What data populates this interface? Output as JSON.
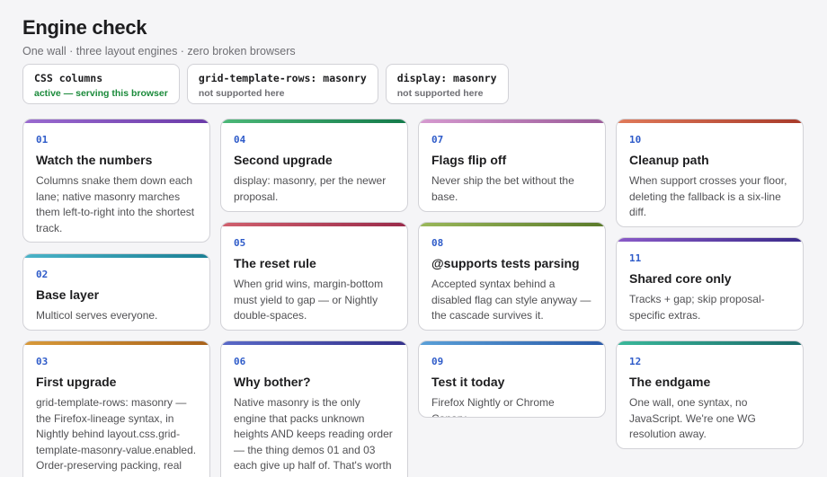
{
  "header": {
    "title": "Engine check",
    "subtitle": "One wall · three layout engines · zero broken browsers"
  },
  "engines": [
    {
      "code": "CSS columns",
      "status": "active — serving this browser"
    },
    {
      "code": "grid-template-rows: masonry",
      "status": "not supported here"
    },
    {
      "code": "display: masonry",
      "status": "not supported here"
    }
  ],
  "cards": [
    {
      "num": "01",
      "title": "Watch the numbers",
      "desc": "Columns snake them down each lane; native masonry marches them left-to-right into the shortest track.",
      "color_a": "#9a6bd0",
      "color_b": "#6a3aa8"
    },
    {
      "num": "02",
      "title": "Base layer",
      "desc": "Multicol serves everyone.",
      "color_a": "#4ab3c8",
      "color_b": "#1a7f94"
    },
    {
      "num": "03",
      "title": "First upgrade",
      "desc": "grid-template-rows: masonry — the Firefox-lineage syntax, in Nightly behind layout.css.grid-template-masonry-value.enabled. Order-preserving packing, real grid tracks, subgrid-friendly.",
      "color_a": "#d89a3a",
      "color_b": "#a8621a"
    },
    {
      "num": "04",
      "title": "Second upgrade",
      "desc": "display: masonry, per the newer proposal.",
      "color_a": "#4cb878",
      "color_b": "#137a4a"
    },
    {
      "num": "05",
      "title": "The reset rule",
      "desc": "When grid wins, margin-bottom must yield to gap — or Nightly double-spaces.",
      "color_a": "#d0606e",
      "color_b": "#9a2a4a"
    },
    {
      "num": "06",
      "title": "Why bother?",
      "desc": "Native masonry is the only engine that packs unknown heights AND keeps reading order — the thing demos 01 and 03 each give up half of. That's worth a three-line bet on the future.",
      "color_a": "#5a6ac8",
      "color_b": "#34308a"
    },
    {
      "num": "07",
      "title": "Flags flip off",
      "desc": "Never ship the bet without the base.",
      "color_a": "#d69ad0",
      "color_b": "#9a5a98"
    },
    {
      "num": "08",
      "title": "@supports tests parsing",
      "desc": "Accepted syntax behind a disabled flag can style anyway — the cascade survives it.",
      "color_a": "#9ab85a",
      "color_b": "#5a7a2a"
    },
    {
      "num": "09",
      "title": "Test it today",
      "desc": "Firefox Nightly or Chrome Canary.",
      "color_a": "#5aa0d8",
      "color_b": "#2a5aa8"
    },
    {
      "num": "10",
      "title": "Cleanup path",
      "desc": "When support crosses your floor, deleting the fallback is a six-line diff.",
      "color_a": "#e07a5a",
      "color_b": "#a83a2a"
    },
    {
      "num": "11",
      "title": "Shared core only",
      "desc": "Tracks + gap; skip proposal-specific extras.",
      "color_a": "#8a5ac8",
      "color_b": "#3a2a8a"
    },
    {
      "num": "12",
      "title": "The endgame",
      "desc": "One wall, one syntax, no JavaScript. We're one WG resolution away.",
      "color_a": "#3ab89a",
      "color_b": "#1a6a6a"
    }
  ]
}
